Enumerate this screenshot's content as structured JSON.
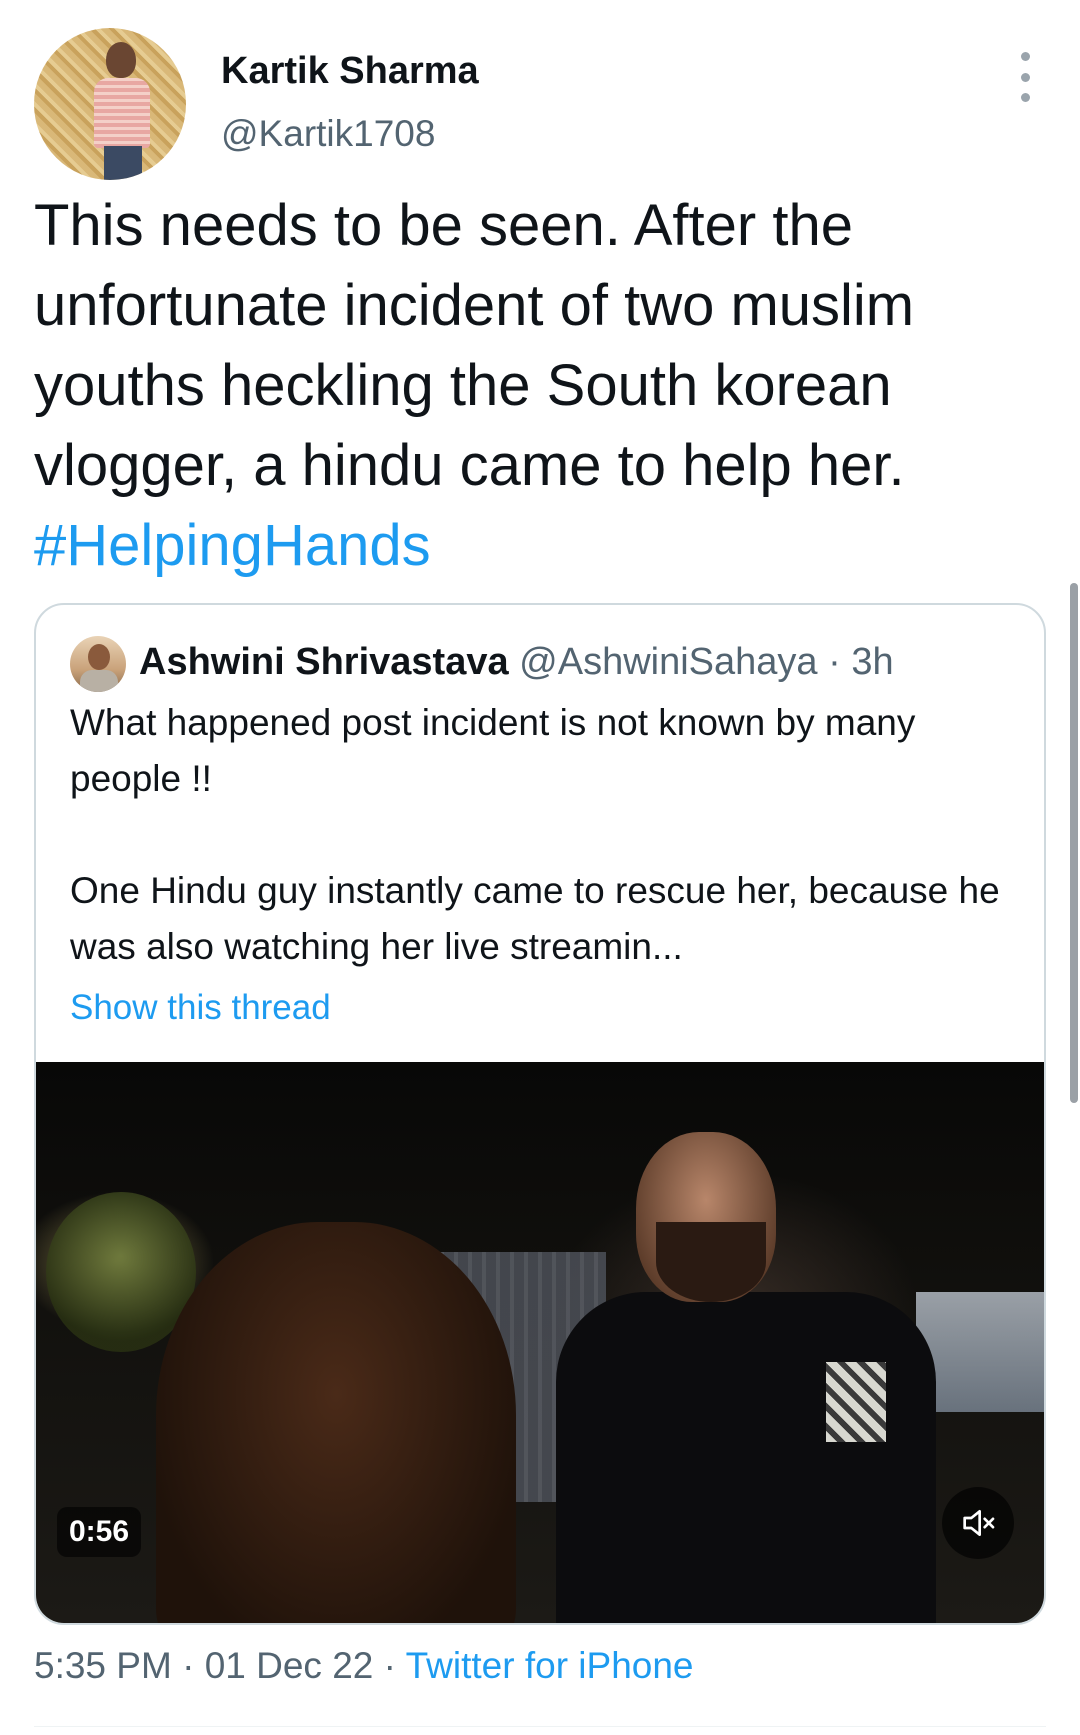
{
  "tweet": {
    "author": {
      "name": "Kartik Sharma",
      "handle": "@Kartik1708"
    },
    "text": "This needs to be seen. After the unfortunate incident of two muslim youths heckling the South korean vlogger, a hindu came to help her.",
    "hashtag": "#HelpingHands",
    "timestamp": "5:35 PM",
    "separator": "·",
    "date": "01 Dec 22",
    "source": "Twitter for iPhone"
  },
  "quote": {
    "author_name": "Ashwini Shrivastava",
    "author_handle": "@AshwiniSahaya",
    "time_meta": "· 3h",
    "line1": "What happened post incident is not known by many people !!",
    "line2": "One Hindu guy instantly came to rescue her, because he was also watching her live streamin...",
    "show_thread": "Show this thread",
    "video": {
      "duration": "0:56"
    }
  },
  "icons": {
    "more": "more-vertical-icon",
    "mute": "speaker-muted-icon"
  },
  "colors": {
    "link": "#1d9bf0",
    "secondary_text": "#536471",
    "primary_text": "#0f1419",
    "border": "#cfd9de"
  }
}
